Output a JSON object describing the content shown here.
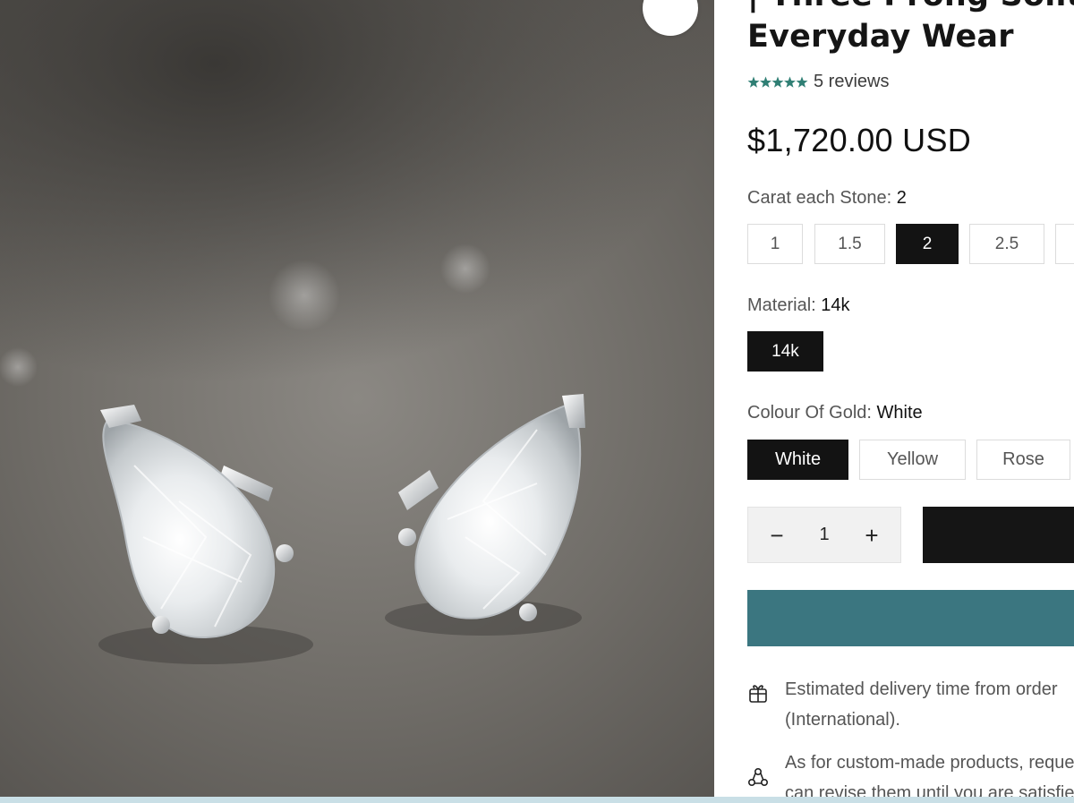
{
  "product": {
    "title_line1": "| Three Prong Solitaire",
    "title_line2": "Everyday Wear",
    "reviews_text": "5 reviews",
    "rating": 5,
    "rating_color": "#2f7f74",
    "price": "$1,720.00 USD"
  },
  "options": {
    "carat": {
      "label": "Carat each Stone:",
      "selected": "2",
      "values": [
        "1",
        "1.5",
        "2",
        "2.5",
        ""
      ]
    },
    "material": {
      "label": "Material:",
      "selected": "14k",
      "values": [
        "14k"
      ]
    },
    "gold_colour": {
      "label": "Colour Of Gold:",
      "selected": "White",
      "values": [
        "White",
        "Yellow",
        "Rose"
      ]
    }
  },
  "quantity": {
    "minus": "−",
    "value": "1",
    "plus": "+"
  },
  "notes": [
    {
      "icon": "delivery-icon",
      "line1": "Estimated delivery time from order",
      "line2": "(International)."
    },
    {
      "icon": "custom-icon",
      "line1": "As for custom-made products, requests",
      "line2": "can revise them until you are satisfied"
    }
  ],
  "colors": {
    "selected_chip": "#131313",
    "buy_button": "#3b7680",
    "add_to_cart": "#151515"
  }
}
